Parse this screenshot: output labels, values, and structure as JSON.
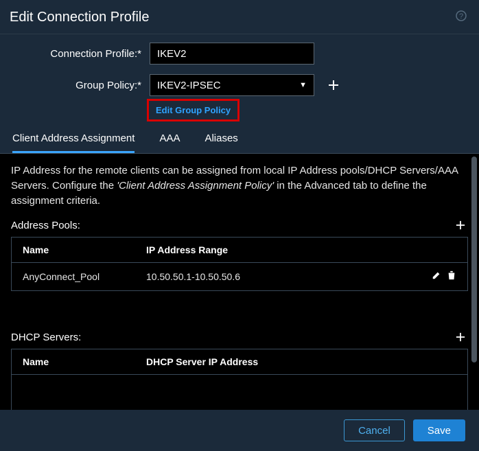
{
  "dialog": {
    "title": "Edit Connection Profile"
  },
  "form": {
    "connection_profile": {
      "label": "Connection Profile:*",
      "value": "IKEV2"
    },
    "group_policy": {
      "label": "Group Policy:*",
      "value": "IKEV2-IPSEC",
      "edit_link": "Edit Group Policy"
    }
  },
  "tabs": {
    "client_addr": "Client Address Assignment",
    "aaa": "AAA",
    "aliases": "Aliases"
  },
  "content": {
    "desc_pre": "IP Address for the remote clients can be assigned from local IP Address pools/DHCP Servers/AAA Servers. Configure the ",
    "desc_italic": "'Client Address Assignment Policy'",
    "desc_post": " in the Advanced tab to define the assignment criteria.",
    "address_pools": {
      "label": "Address Pools:",
      "columns": {
        "name": "Name",
        "range": "IP Address Range"
      },
      "rows": [
        {
          "name": "AnyConnect_Pool",
          "range": "10.50.50.1-10.50.50.6"
        }
      ]
    },
    "dhcp_servers": {
      "label": "DHCP Servers:",
      "columns": {
        "name": "Name",
        "ip": "DHCP Server IP Address"
      }
    }
  },
  "footer": {
    "cancel": "Cancel",
    "save": "Save"
  }
}
